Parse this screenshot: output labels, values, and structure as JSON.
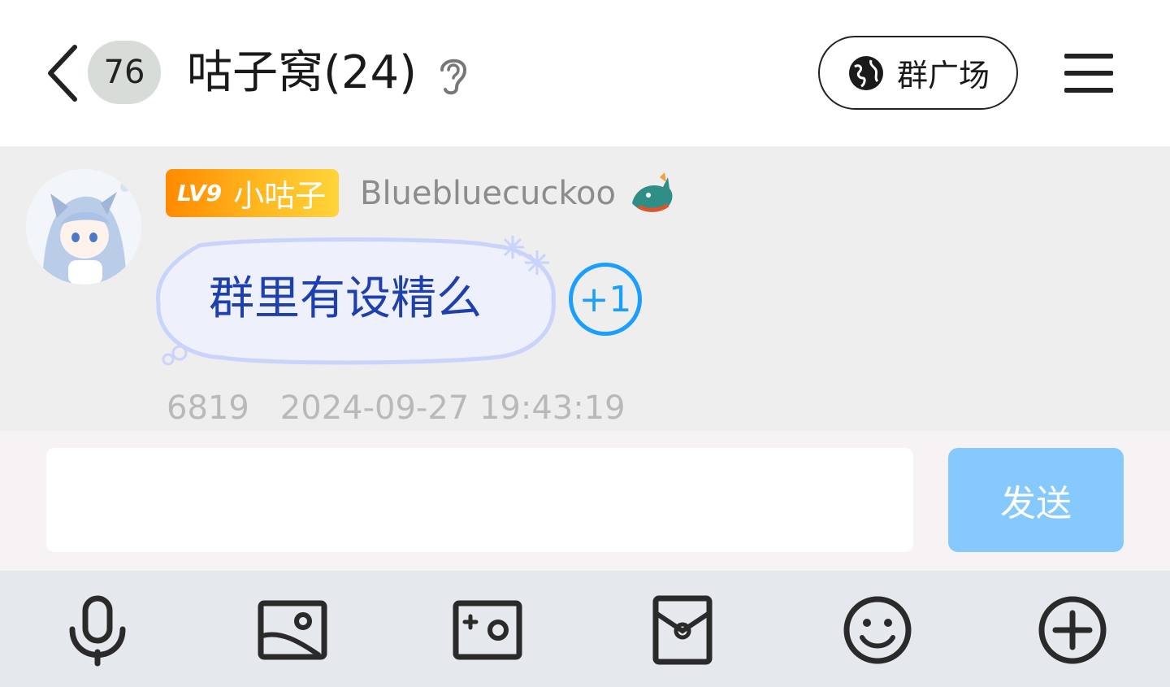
{
  "header": {
    "unread_count": "76",
    "title": "咕子窝(24)",
    "square_button_label": "群广场"
  },
  "message": {
    "level_badge": "LV9",
    "title_tag": "小咕子",
    "username": "Bluebluecuckoo",
    "text": "群里有设精么",
    "plus_one": "+1",
    "count": "6819",
    "timestamp": "2024-09-27 19:43:19"
  },
  "input": {
    "value": "",
    "send_label": "发送"
  },
  "toolbar": {
    "icons": [
      "microphone-icon",
      "image-icon",
      "camera-icon",
      "red-packet-icon",
      "emoji-icon",
      "plus-circle-icon"
    ]
  },
  "colors": {
    "accent_blue": "#1a9fff",
    "message_text": "#1e3fae",
    "send_button": "#80c7ff",
    "level_gradient_start": "#ff8a00",
    "level_gradient_end": "#ffd43a"
  }
}
